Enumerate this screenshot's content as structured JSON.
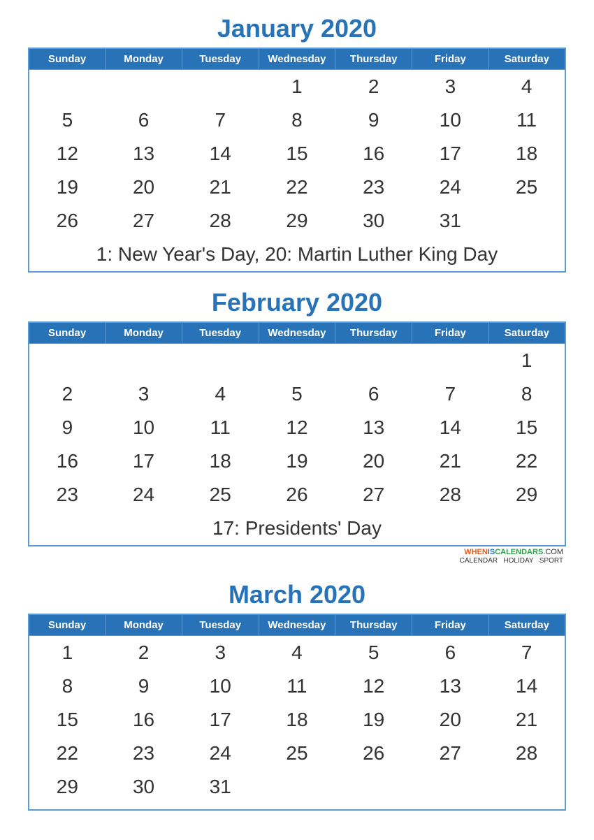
{
  "calendars": [
    {
      "id": "january-2020",
      "title": "January 2020",
      "headers": [
        "Sunday",
        "Monday",
        "Tuesday",
        "Wednesday",
        "Thursday",
        "Friday",
        "Saturday"
      ],
      "weeks": [
        [
          "",
          "",
          "",
          "1",
          "2",
          "3",
          "4"
        ],
        [
          "5",
          "6",
          "7",
          "8",
          "9",
          "10",
          "11"
        ],
        [
          "12",
          "13",
          "14",
          "15",
          "16",
          "17",
          "18"
        ],
        [
          "19",
          "20",
          "21",
          "22",
          "23",
          "24",
          "25"
        ],
        [
          "26",
          "27",
          "28",
          "29",
          "30",
          "31",
          ""
        ]
      ],
      "holidays": "1: New Year's Day, 20: Martin Luther King Day",
      "show_watermark": false
    },
    {
      "id": "february-2020",
      "title": "February 2020",
      "headers": [
        "Sunday",
        "Monday",
        "Tuesday",
        "Wednesday",
        "Thursday",
        "Friday",
        "Saturday"
      ],
      "weeks": [
        [
          "",
          "",
          "",
          "",
          "",
          "",
          "1"
        ],
        [
          "2",
          "3",
          "4",
          "5",
          "6",
          "7",
          "8"
        ],
        [
          "9",
          "10",
          "11",
          "12",
          "13",
          "14",
          "15"
        ],
        [
          "16",
          "17",
          "18",
          "19",
          "20",
          "21",
          "22"
        ],
        [
          "23",
          "24",
          "25",
          "26",
          "27",
          "28",
          "29"
        ]
      ],
      "holidays": "17: Presidents' Day",
      "show_watermark": true
    },
    {
      "id": "march-2020",
      "title": "March 2020",
      "headers": [
        "Sunday",
        "Monday",
        "Tuesday",
        "Wednesday",
        "Thursday",
        "Friday",
        "Saturday"
      ],
      "weeks": [
        [
          "1",
          "2",
          "3",
          "4",
          "5",
          "6",
          "7"
        ],
        [
          "8",
          "9",
          "10",
          "11",
          "12",
          "13",
          "14"
        ],
        [
          "15",
          "16",
          "17",
          "18",
          "19",
          "20",
          "21"
        ],
        [
          "22",
          "23",
          "24",
          "25",
          "26",
          "27",
          "28"
        ],
        [
          "29",
          "30",
          "31",
          "",
          "",
          "",
          ""
        ]
      ],
      "holidays": "",
      "show_watermark": false
    }
  ],
  "watermark": {
    "when": "WHEN",
    "is": "IS",
    "cal": "CALENDARS",
    "dot": ".COM",
    "sub": "CALENDAR  HOLIDAY  SPORT"
  }
}
